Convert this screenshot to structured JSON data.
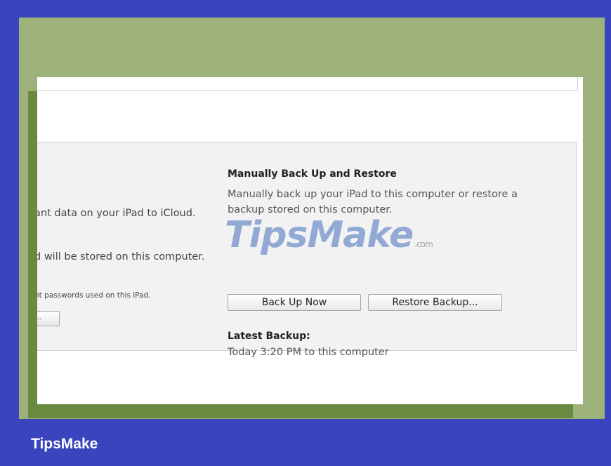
{
  "backup_section": {
    "heading": "Manually Back Up and Restore",
    "description": "Manually back up your iPad to this computer or restore a backup stored on this computer.",
    "back_up_now_label": "Back Up Now",
    "restore_backup_label": "Restore Backup...",
    "latest_backup_label": "Latest Backup:",
    "latest_backup_value": "Today 3:20 PM to this computer"
  },
  "left_section": {
    "line1": "ant data on your iPad to iCloud.",
    "line2": "d will be stored on this computer.",
    "line3": "nt passwords used on this iPad.",
    "button_label": "..."
  },
  "watermark": {
    "text": "TipsMake",
    "suffix": ".com"
  },
  "footer": {
    "brand": "TipsMake"
  },
  "colors": {
    "frame_blue": "#3a44bd",
    "green": "#9cb27a",
    "dark_green": "#6a8a3f"
  }
}
